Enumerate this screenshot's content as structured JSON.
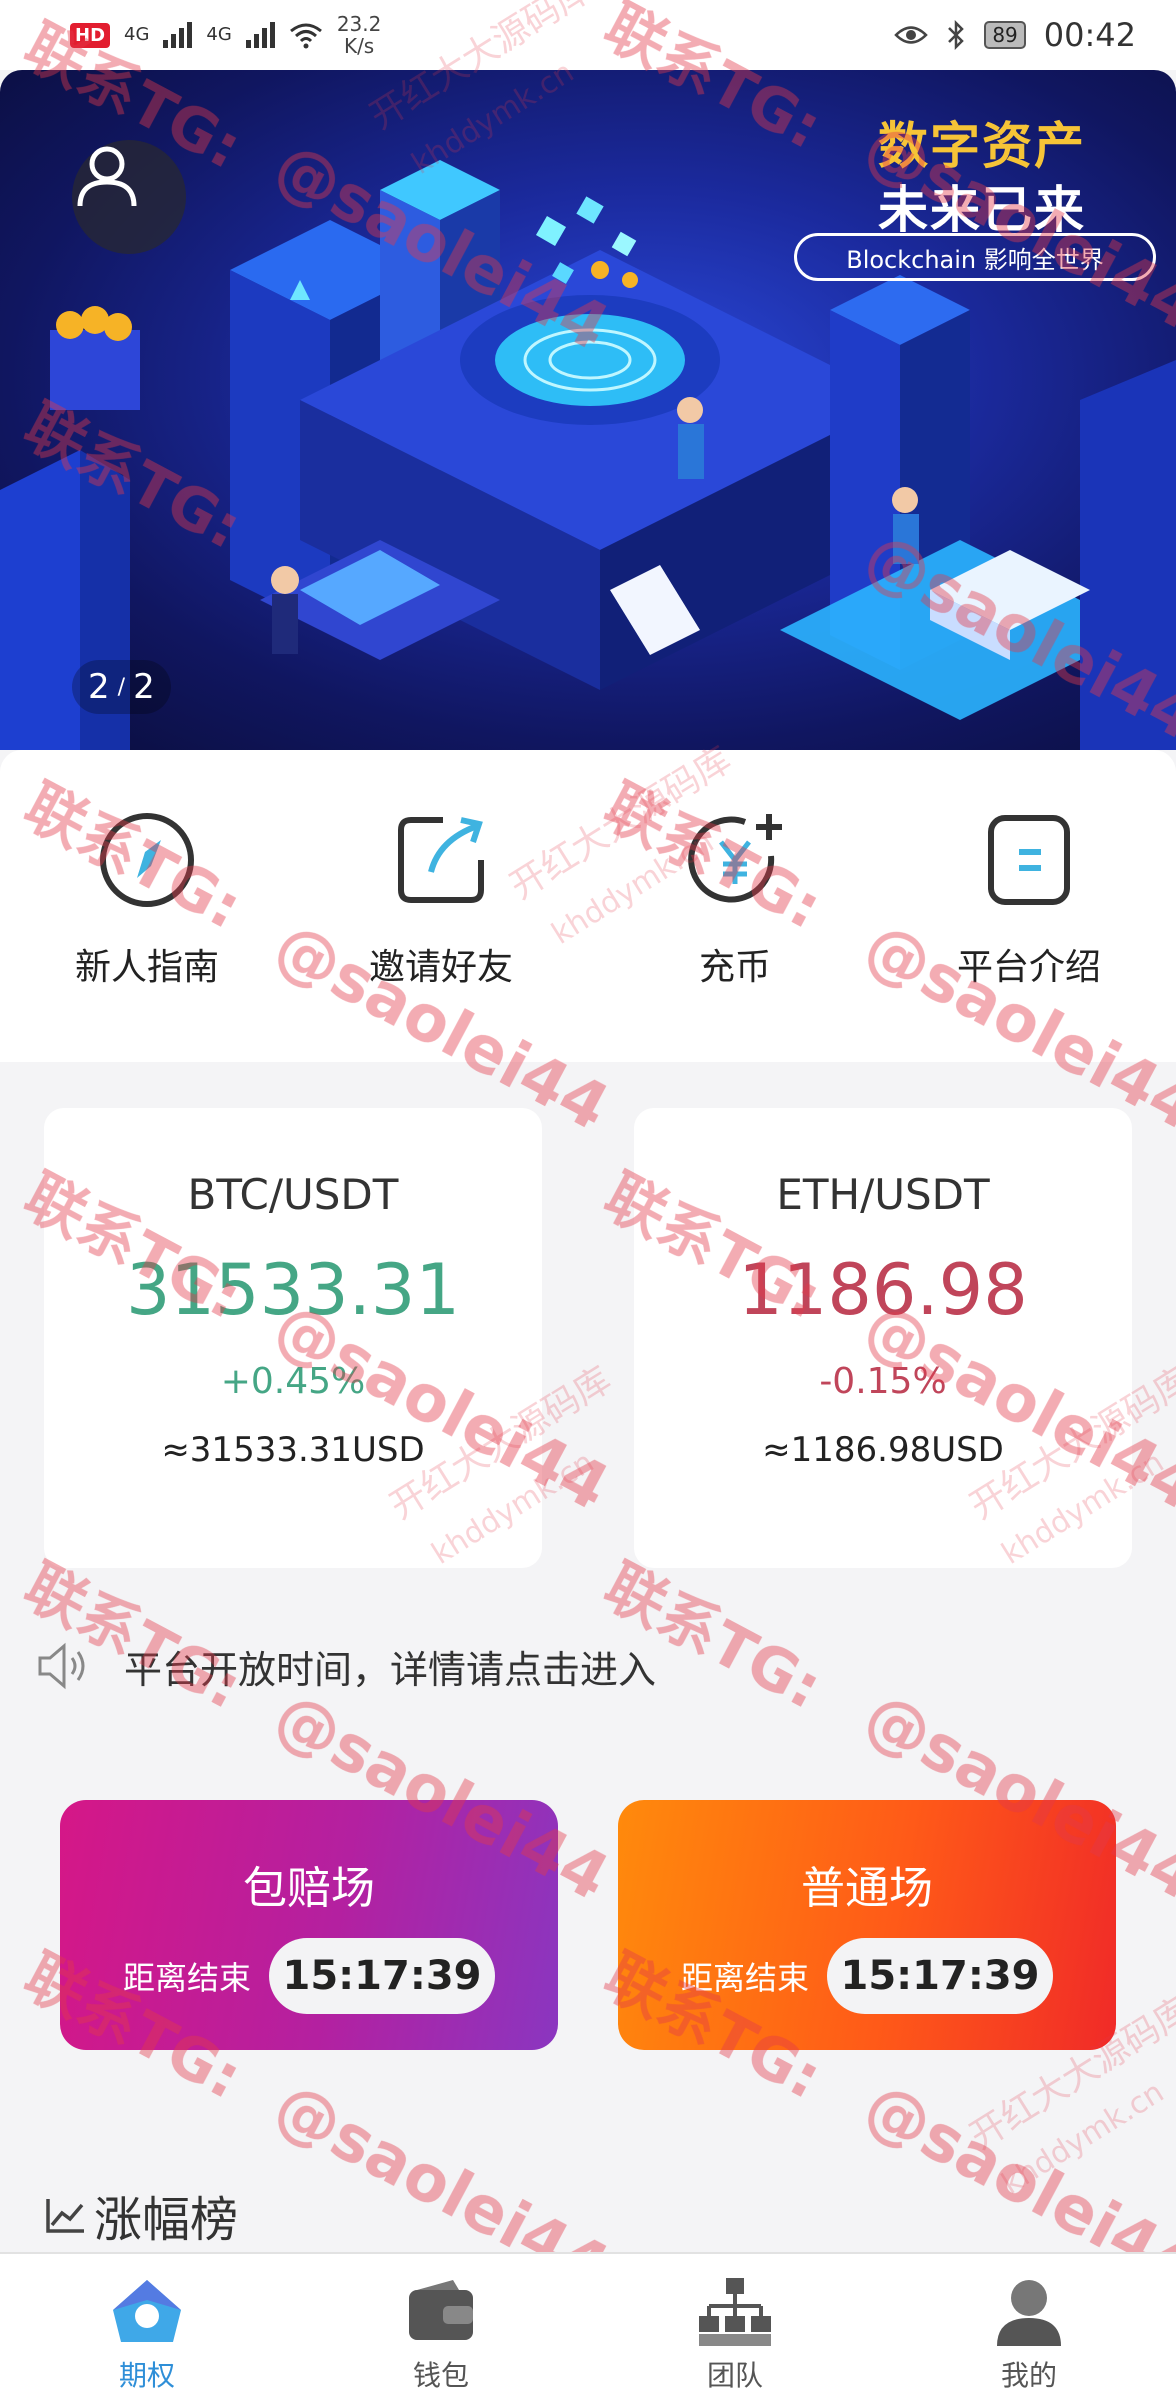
{
  "status_bar": {
    "hd": "HD",
    "network_1": "4G",
    "network_2": "4G",
    "speed_value": "23.2",
    "speed_unit": "K/s",
    "battery": "89",
    "time": "00:42"
  },
  "banner": {
    "title_line1": "数字资产",
    "title_line2": "未来已来",
    "tagline": "Blockchain 影响全世界",
    "pager_current": "2",
    "pager_total": "2",
    "colors": {
      "title_accent": "#f6c437",
      "background": "#1b2a9e"
    }
  },
  "quick_menu": [
    {
      "label": "新人指南",
      "icon": "compass-icon"
    },
    {
      "label": "邀请好友",
      "icon": "invite-share-icon"
    },
    {
      "label": "充币",
      "icon": "recharge-yen-icon"
    },
    {
      "label": "平台介绍",
      "icon": "document-icon"
    }
  ],
  "tickers": [
    {
      "pair": "BTC/USDT",
      "price": "31533.31",
      "change": "+0.45%",
      "usd": "≈31533.31USD",
      "trend": "up"
    },
    {
      "pair": "ETH/USDT",
      "price": "1186.98",
      "change": "-0.15%",
      "usd": "≈1186.98USD",
      "trend": "down"
    }
  ],
  "notice": {
    "icon": "speaker-icon",
    "text": "平台开放时间，详情请点击进入"
  },
  "sessions": [
    {
      "name": "包赔场",
      "countdown_label": "距离结束",
      "countdown": "15:17:39"
    },
    {
      "name": "普通场",
      "countdown_label": "距离结束",
      "countdown": "15:17:39"
    }
  ],
  "ranking": {
    "icon": "trend-chart-icon",
    "title": "涨幅榜"
  },
  "tabbar": [
    {
      "label": "期权",
      "icon": "home-icon",
      "active": true
    },
    {
      "label": "钱包",
      "icon": "wallet-icon",
      "active": false
    },
    {
      "label": "团队",
      "icon": "team-hierarchy-icon",
      "active": false
    },
    {
      "label": "我的",
      "icon": "profile-icon",
      "active": false
    }
  ],
  "watermark": {
    "line1": "联系TG:",
    "line2": "@saolei44",
    "line3": "开红大大源码库",
    "line4": "khddymk.cn"
  },
  "colors": {
    "up": "#45a685",
    "down": "#c0455a",
    "tab_active": "#2f8fd8"
  }
}
